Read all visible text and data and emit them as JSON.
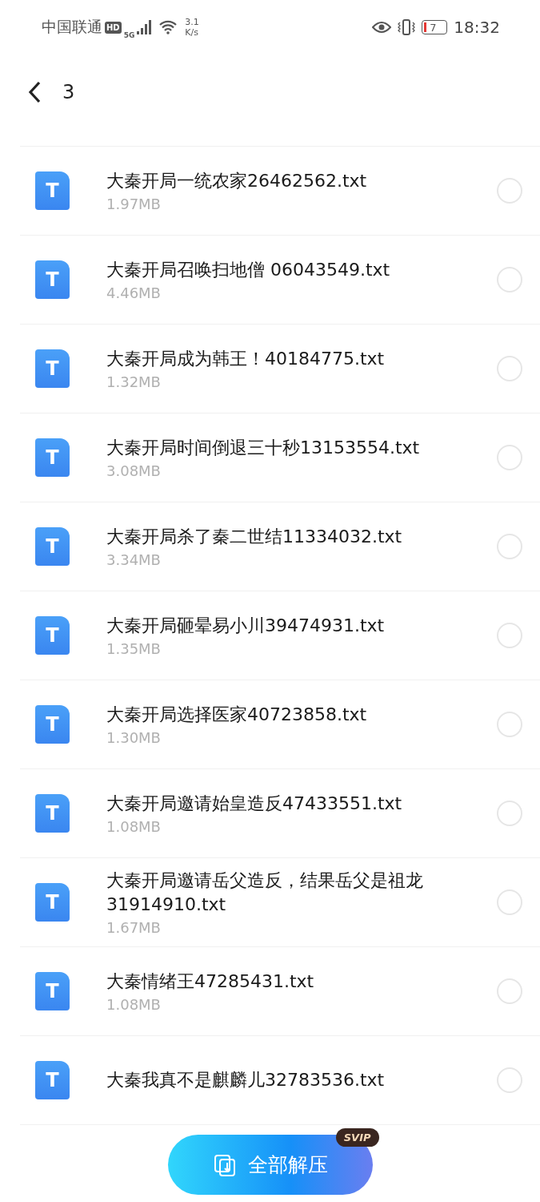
{
  "status_bar": {
    "carrier": "中国联通",
    "hd_badge": "HD",
    "network": "5G",
    "speed_value": "3.1",
    "speed_unit": "K/s",
    "battery_level": "7",
    "time": "18:32"
  },
  "header": {
    "title": "3"
  },
  "files": [
    {
      "icon_text": "T",
      "name": "大秦开局一统农家26462562.txt",
      "size": "1.97MB",
      "selected": false
    },
    {
      "icon_text": "T",
      "name": "大秦开局召唤扫地僧 06043549.txt",
      "size": "4.46MB",
      "selected": false
    },
    {
      "icon_text": "T",
      "name": "大秦开局成为韩王！40184775.txt",
      "size": "1.32MB",
      "selected": false
    },
    {
      "icon_text": "T",
      "name": "大秦开局时间倒退三十秒13153554.txt",
      "size": "3.08MB",
      "selected": false
    },
    {
      "icon_text": "T",
      "name": "大秦开局杀了秦二世结11334032.txt",
      "size": "3.34MB",
      "selected": false
    },
    {
      "icon_text": "T",
      "name": "大秦开局砸晕易小川39474931.txt",
      "size": "1.35MB",
      "selected": false
    },
    {
      "icon_text": "T",
      "name": "大秦开局选择医家40723858.txt",
      "size": "1.30MB",
      "selected": false
    },
    {
      "icon_text": "T",
      "name": "大秦开局邀请始皇造反47433551.txt",
      "size": "1.08MB",
      "selected": false
    },
    {
      "icon_text": "T",
      "name": "大秦开局邀请岳父造反，结果岳父是祖龙31914910.txt",
      "size": "1.67MB",
      "selected": false
    },
    {
      "icon_text": "T",
      "name": "大秦情绪王47285431.txt",
      "size": "1.08MB",
      "selected": false
    },
    {
      "icon_text": "T",
      "name": "大秦我真不是麒麟儿32783536.txt",
      "selected": false
    }
  ],
  "action_button": {
    "label": "全部解压",
    "badge": "SVIP"
  }
}
